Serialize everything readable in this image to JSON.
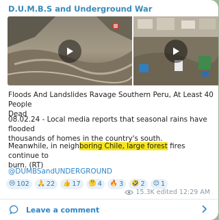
{
  "channel": {
    "name": "D.U.M.B.S and Underground War"
  },
  "media": [
    {
      "kind": "video",
      "icon": "play-icon"
    },
    {
      "kind": "video",
      "icon": "play-icon"
    }
  ],
  "post": {
    "title_line1": "Floods And Landslides Ravage Southern Peru, At Least 40 People",
    "title_line2": "Dead",
    "p1_line1": "08.02.24 - Local media reports that seasonal rains have flooded",
    "p1_line2": "thousands of homes in the country's south.",
    "p2_line1_plain": "Meanwhile, in neigh",
    "p2_line1_hl": "boring Chile, large forest",
    "p2_line1_end": " fires continue to",
    "p2_line2_plain": "burn. (RT)",
    "hashtag": "@DUMBSandUNDERGROUND",
    "highlight_color": "#f8e619"
  },
  "reactions": [
    {
      "icon": "crying-face-icon",
      "emoji": "😢",
      "count": "102"
    },
    {
      "icon": "praying-hands-icon",
      "emoji": "🙏",
      "count": "22"
    },
    {
      "icon": "thumbs-up-icon",
      "emoji": "👍",
      "count": "17"
    },
    {
      "icon": "thinking-face-icon",
      "emoji": "🤔",
      "count": "4"
    },
    {
      "icon": "fire-icon",
      "emoji": "🔥",
      "count": "3"
    },
    {
      "icon": "rofl-face-icon",
      "emoji": "🤣",
      "count": "2"
    },
    {
      "icon": "smiling-face-icon",
      "emoji": "😊",
      "count": "1"
    }
  ],
  "meta": {
    "views": "15.3K",
    "edited": "edited 12:29 AM"
  },
  "comment": {
    "label": "Leave a comment"
  },
  "colors": {
    "accent": "#2e84c7",
    "channel_name": "#3a8ab8",
    "background": "#9fb89a"
  }
}
